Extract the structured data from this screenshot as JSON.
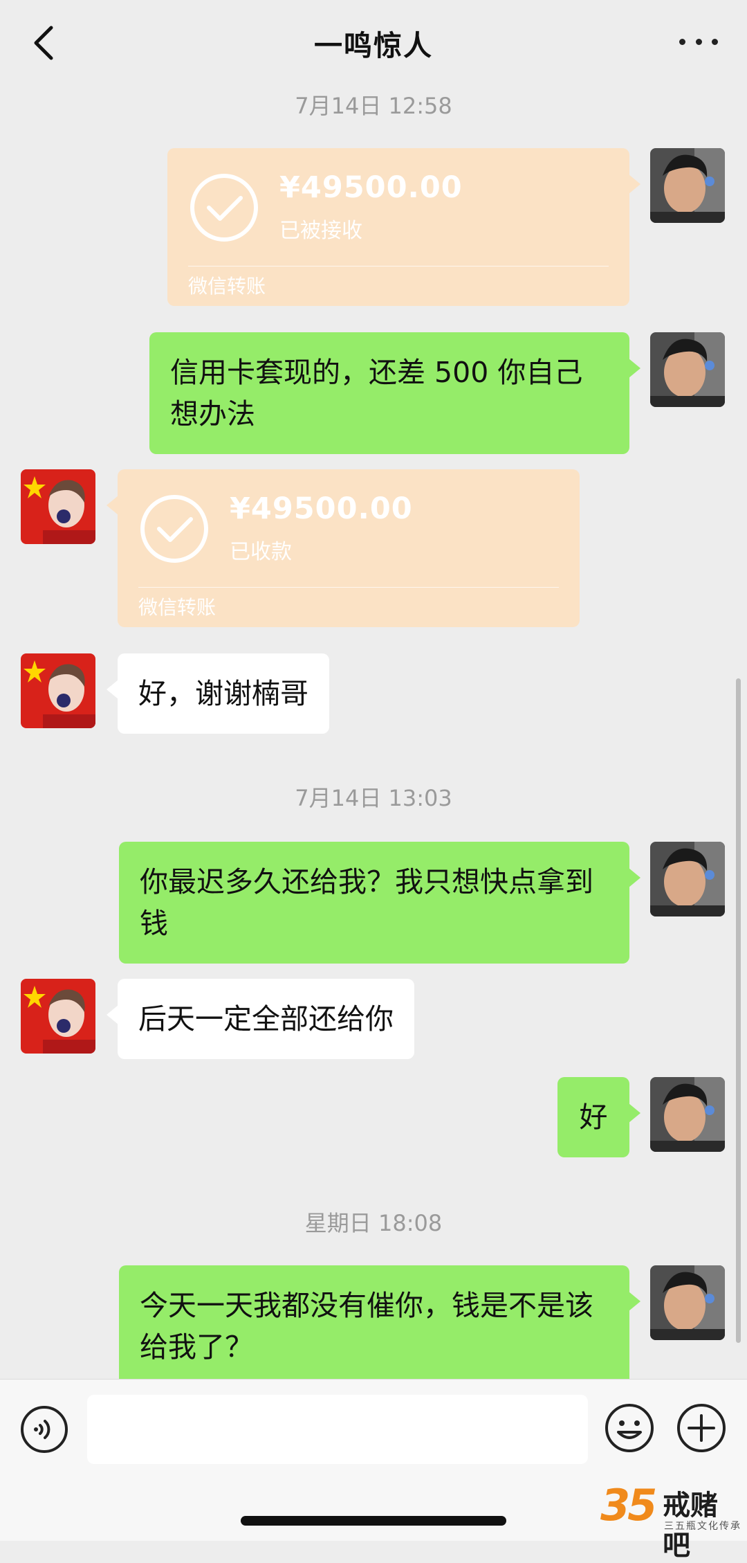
{
  "header": {
    "title": "一鸣惊人"
  },
  "messages": [
    {
      "type": "time",
      "text": "7月14日 12:58"
    },
    {
      "type": "transfer",
      "side": "right",
      "amount": "¥49500.00",
      "status": "已被接收",
      "footer": "微信转账"
    },
    {
      "type": "text",
      "side": "right",
      "text": "信用卡套现的，还差 500 你自己想办法"
    },
    {
      "type": "transfer",
      "side": "left",
      "amount": "¥49500.00",
      "status": "已收款",
      "footer": "微信转账"
    },
    {
      "type": "text",
      "side": "left",
      "text": "好，谢谢楠哥"
    },
    {
      "type": "time",
      "text": "7月14日 13:03"
    },
    {
      "type": "text",
      "side": "right",
      "text": "你最迟多久还给我？我只想快点拿到钱"
    },
    {
      "type": "text",
      "side": "left",
      "text": "后天一定全部还给你"
    },
    {
      "type": "text",
      "side": "right",
      "text": "好"
    },
    {
      "type": "time",
      "text": "星期日 18:08"
    },
    {
      "type": "text",
      "side": "right",
      "text": "今天一天我都没有催你，钱是不是该给我了？"
    }
  ],
  "input": {
    "placeholder": ""
  },
  "watermark": {
    "number": "35",
    "name": "戒赌吧",
    "subtitle": "三五瓶文化传承"
  },
  "colors": {
    "background": "#ededed",
    "my_bubble": "#95ec69",
    "their_bubble": "#ffffff",
    "transfer_card": "#fbe2c5"
  },
  "icons": {
    "back": "chevron-left-icon",
    "more": "more-dots-icon",
    "voice": "voice-icon",
    "emoji": "emoji-icon",
    "plus": "plus-icon",
    "transfer_done": "check-circle-icon"
  }
}
